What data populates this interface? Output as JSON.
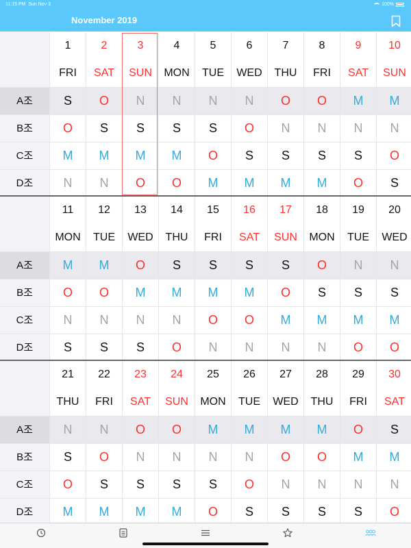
{
  "status_bar": {
    "time": "11:15 PM",
    "date": "Sun Nov 3",
    "battery": "100%"
  },
  "header": {
    "title": "November 2019",
    "bookmark_icon": "bookmark-icon"
  },
  "crew_labels": [
    "A조",
    "B조",
    "C조",
    "D조"
  ],
  "weeks": [
    {
      "days": [
        {
          "num": "1",
          "dow": "FRI",
          "color": "black"
        },
        {
          "num": "2",
          "dow": "SAT",
          "color": "red"
        },
        {
          "num": "3",
          "dow": "SUN",
          "color": "red"
        },
        {
          "num": "4",
          "dow": "MON",
          "color": "black"
        },
        {
          "num": "5",
          "dow": "TUE",
          "color": "black"
        },
        {
          "num": "6",
          "dow": "WED",
          "color": "black"
        },
        {
          "num": "7",
          "dow": "THU",
          "color": "black"
        },
        {
          "num": "8",
          "dow": "FRI",
          "color": "black"
        },
        {
          "num": "9",
          "dow": "SAT",
          "color": "red"
        },
        {
          "num": "10",
          "dow": "SUN",
          "color": "red"
        }
      ],
      "rows": [
        [
          "S",
          "O",
          "N",
          "N",
          "N",
          "N",
          "O",
          "O",
          "M",
          "M"
        ],
        [
          "O",
          "S",
          "S",
          "S",
          "S",
          "O",
          "N",
          "N",
          "N",
          "N"
        ],
        [
          "M",
          "M",
          "M",
          "M",
          "O",
          "S",
          "S",
          "S",
          "S",
          "O"
        ],
        [
          "N",
          "N",
          "O",
          "O",
          "M",
          "M",
          "M",
          "M",
          "O",
          "S"
        ]
      ]
    },
    {
      "days": [
        {
          "num": "11",
          "dow": "MON",
          "color": "black"
        },
        {
          "num": "12",
          "dow": "TUE",
          "color": "black"
        },
        {
          "num": "13",
          "dow": "WED",
          "color": "black"
        },
        {
          "num": "14",
          "dow": "THU",
          "color": "black"
        },
        {
          "num": "15",
          "dow": "FRI",
          "color": "black"
        },
        {
          "num": "16",
          "dow": "SAT",
          "color": "red"
        },
        {
          "num": "17",
          "dow": "SUN",
          "color": "red"
        },
        {
          "num": "18",
          "dow": "MON",
          "color": "black"
        },
        {
          "num": "19",
          "dow": "TUE",
          "color": "black"
        },
        {
          "num": "20",
          "dow": "WED",
          "color": "black"
        }
      ],
      "rows": [
        [
          "M",
          "M",
          "O",
          "S",
          "S",
          "S",
          "S",
          "O",
          "N",
          "N"
        ],
        [
          "O",
          "O",
          "M",
          "M",
          "M",
          "M",
          "O",
          "S",
          "S",
          "S"
        ],
        [
          "N",
          "N",
          "N",
          "N",
          "O",
          "O",
          "M",
          "M",
          "M",
          "M"
        ],
        [
          "S",
          "S",
          "S",
          "O",
          "N",
          "N",
          "N",
          "N",
          "O",
          "O"
        ]
      ]
    },
    {
      "days": [
        {
          "num": "21",
          "dow": "THU",
          "color": "black"
        },
        {
          "num": "22",
          "dow": "FRI",
          "color": "black"
        },
        {
          "num": "23",
          "dow": "SAT",
          "color": "red"
        },
        {
          "num": "24",
          "dow": "SUN",
          "color": "red"
        },
        {
          "num": "25",
          "dow": "MON",
          "color": "black"
        },
        {
          "num": "26",
          "dow": "TUE",
          "color": "black"
        },
        {
          "num": "27",
          "dow": "WED",
          "color": "black"
        },
        {
          "num": "28",
          "dow": "THU",
          "color": "black"
        },
        {
          "num": "29",
          "dow": "FRI",
          "color": "black"
        },
        {
          "num": "30",
          "dow": "SAT",
          "color": "red"
        }
      ],
      "rows": [
        [
          "N",
          "N",
          "O",
          "O",
          "M",
          "M",
          "M",
          "M",
          "O",
          "S"
        ],
        [
          "S",
          "O",
          "N",
          "N",
          "N",
          "N",
          "O",
          "O",
          "M",
          "M"
        ],
        [
          "O",
          "S",
          "S",
          "S",
          "S",
          "O",
          "N",
          "N",
          "N",
          "N"
        ],
        [
          "M",
          "M",
          "M",
          "M",
          "O",
          "S",
          "S",
          "S",
          "S",
          "O"
        ]
      ]
    }
  ],
  "highlighted_crew_index": 0,
  "today": {
    "week": 0,
    "day_index": 2
  },
  "tab_bar": {
    "tabs": [
      "clock-icon",
      "calendar-icon",
      "list-icon",
      "star-icon",
      "people-icon"
    ],
    "active_index": 4
  },
  "colors": {
    "accent": "#5ac8fa",
    "shift_S": "#111111",
    "shift_O": "#ff2d2d",
    "shift_M": "#34aadc",
    "shift_N": "#a3a3a8",
    "weekend": "#ff2d2d"
  }
}
